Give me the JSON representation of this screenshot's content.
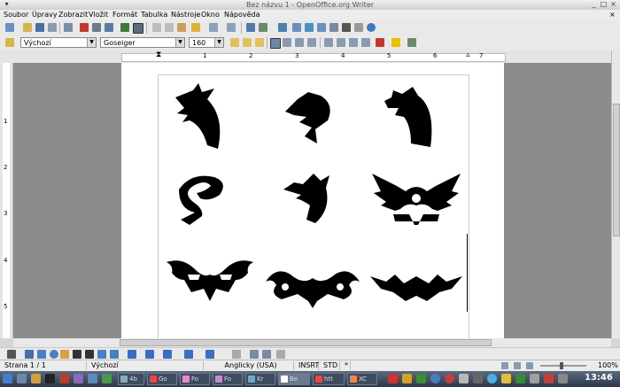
{
  "window": {
    "title": "Bez názvu 1 - OpenOffice.org Writer"
  },
  "menu": [
    {
      "label": "Soubor"
    },
    {
      "label": "Úpravy"
    },
    {
      "label": "Zobrazit"
    },
    {
      "label": "Vložit"
    },
    {
      "label": "Formát"
    },
    {
      "label": "Tabulka"
    },
    {
      "label": "Nástroje"
    },
    {
      "label": "Okno"
    },
    {
      "label": "Nápověda"
    }
  ],
  "formatting": {
    "style_value": "Výchozí",
    "font_value": "Goseiger",
    "size_value": "160"
  },
  "ruler": {
    "numbers": [
      "1",
      "2",
      "3",
      "4",
      "5",
      "6",
      "7"
    ]
  },
  "vruler": {
    "numbers": [
      "1",
      "2",
      "3",
      "4",
      "5"
    ]
  },
  "status": {
    "page": "Strana 1 / 1",
    "style": "Výchozí",
    "language": "Anglicky (USA)",
    "insert_mode": "INSRT",
    "selection_mode": "STD",
    "zoom": "100%"
  },
  "taskbar": {
    "items": [
      {
        "label": "4b"
      },
      {
        "label": "Go"
      },
      {
        "label": "Fo"
      },
      {
        "label": "Fo"
      },
      {
        "label": "Kr"
      },
      {
        "label": "Be"
      },
      {
        "label": "htt"
      },
      {
        "label": "XC"
      }
    ],
    "clock": "13:46"
  },
  "colors": {
    "accent": "#3a6ea5",
    "taskbar": "#2d3748",
    "workspace": "#8c8c8c"
  }
}
